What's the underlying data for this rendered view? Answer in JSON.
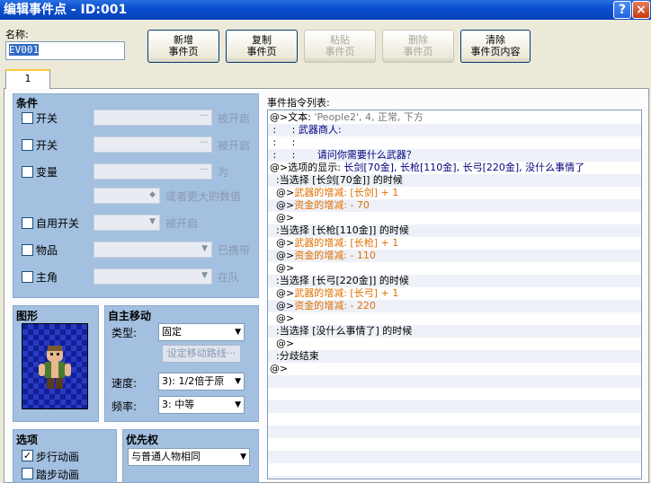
{
  "window": {
    "title": "编辑事件点 - ID:001",
    "help": "?",
    "close": "×"
  },
  "name": {
    "label": "名称:",
    "value": "EV001"
  },
  "toolbar": [
    {
      "l1": "新增",
      "l2": "事件页",
      "enabled": true
    },
    {
      "l1": "复制",
      "l2": "事件页",
      "enabled": true
    },
    {
      "l1": "粘贴",
      "l2": "事件页",
      "enabled": false
    },
    {
      "l1": "删除",
      "l2": "事件页",
      "enabled": false
    },
    {
      "l1": "清除",
      "l2": "事件页内容",
      "enabled": true
    }
  ],
  "tab": "1",
  "conditions": {
    "title": "条件",
    "switch1": {
      "label": "开关",
      "suffix": "被开启"
    },
    "switch2": {
      "label": "开关",
      "suffix": "被开启"
    },
    "variable": {
      "label": "变量",
      "suffix": "为",
      "suffix2": "或者更大的数值"
    },
    "selfswitch": {
      "label": "自用开关",
      "suffix": "被开启"
    },
    "item": {
      "label": "物品",
      "suffix": "已携带"
    },
    "actor": {
      "label": "主角",
      "suffix": "在队"
    }
  },
  "graphic": {
    "title": "图形"
  },
  "movement": {
    "title": "自主移动",
    "type_label": "类型:",
    "type_value": "固定",
    "route_btn": "设定移动路线···",
    "speed_label": "速度:",
    "speed_value": "3): 1/2倍于原",
    "freq_label": "频率:",
    "freq_value": "3: 中等"
  },
  "options": {
    "title": "选项",
    "walk": "步行动画",
    "step": "踏步动画"
  },
  "priority": {
    "title": "优先权",
    "value": "与普通人物相同"
  },
  "command_list": {
    "label": "事件指令列表:"
  },
  "commands": [
    [
      {
        "t": "@>文本: ",
        "c": ""
      },
      {
        "t": "'People2', 4, 正常, 下方",
        "c": "grey2"
      }
    ],
    [
      {
        "t": " :     : ",
        "c": ""
      },
      {
        "t": "武器商人:",
        "c": "navy"
      }
    ],
    [
      {
        "t": " :     :",
        "c": ""
      }
    ],
    [
      {
        "t": " :     :       ",
        "c": ""
      },
      {
        "t": "请问你需要什么武器？",
        "c": "navy"
      }
    ],
    [
      {
        "t": "@>选项的显示: ",
        "c": ""
      },
      {
        "t": "长剑[70金], 长枪[110金], 长弓[220金], 没什么事情了",
        "c": "navy"
      }
    ],
    [
      {
        "t": "  :当选择 [长剑[70金]] 的时候",
        "c": ""
      }
    ],
    [
      {
        "t": "  @>",
        "c": ""
      },
      {
        "t": "武器的增减: [长剑] + 1",
        "c": "orange"
      }
    ],
    [
      {
        "t": "  @>",
        "c": ""
      },
      {
        "t": "资金的增减: - 70",
        "c": "orange"
      }
    ],
    [
      {
        "t": "  @>",
        "c": ""
      }
    ],
    [
      {
        "t": "  :当选择 [长枪[110金]] 的时候",
        "c": ""
      }
    ],
    [
      {
        "t": "  @>",
        "c": ""
      },
      {
        "t": "武器的增减: [长枪] + 1",
        "c": "orange"
      }
    ],
    [
      {
        "t": "  @>",
        "c": ""
      },
      {
        "t": "资金的增减: - 110",
        "c": "orange"
      }
    ],
    [
      {
        "t": "  @>",
        "c": ""
      }
    ],
    [
      {
        "t": "  :当选择 [长弓[220金]] 的时候",
        "c": ""
      }
    ],
    [
      {
        "t": "  @>",
        "c": ""
      },
      {
        "t": "武器的增减: [长弓] + 1",
        "c": "orange"
      }
    ],
    [
      {
        "t": "  @>",
        "c": ""
      },
      {
        "t": "资金的增减: - 220",
        "c": "orange"
      }
    ],
    [
      {
        "t": "  @>",
        "c": ""
      }
    ],
    [
      {
        "t": "  :当选择 [没什么事情了] 的时候",
        "c": ""
      }
    ],
    [
      {
        "t": "  @>",
        "c": ""
      }
    ],
    [
      {
        "t": "  :分歧结束",
        "c": ""
      }
    ],
    [
      {
        "t": "@>",
        "c": ""
      }
    ]
  ]
}
